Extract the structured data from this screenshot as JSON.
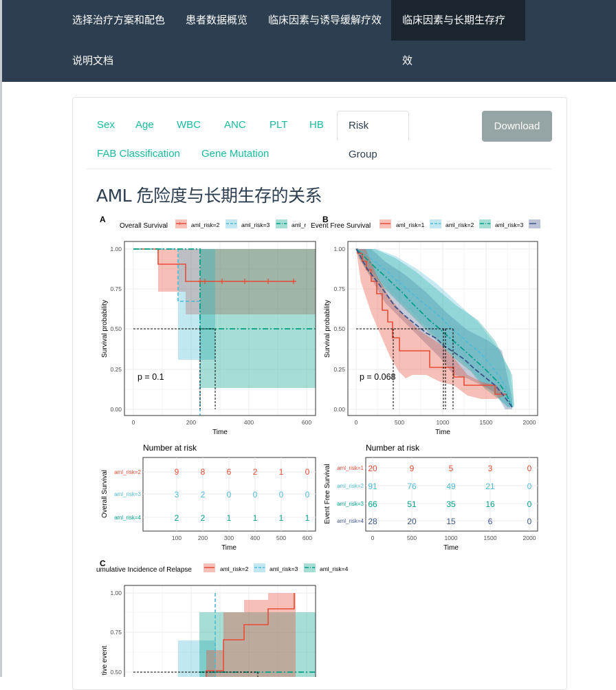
{
  "navbar": {
    "items": [
      "选择治疗方案和配色",
      "患者数据概览",
      "临床因素与诱导缓解疗效",
      "临床因素与长期生存疗效",
      "说明文档"
    ],
    "active_index": 3
  },
  "tabs": {
    "items": [
      "Sex",
      "Age",
      "WBC",
      "ANC",
      "PLT",
      "HB",
      "Risk Group",
      "FAB Classification",
      "Gene Mutation"
    ],
    "active": "Risk Group"
  },
  "download_label": "Download",
  "page_title": "AML 危险度与长期生存的关系",
  "colors": {
    "risk1": "#e64b35",
    "risk2": "#4dbbd5",
    "risk3": "#00a087",
    "risk4": "#3c5488",
    "nav_bg": "#2c3e50",
    "tab_link": "#18bc9c"
  },
  "figure": {
    "panel_a": {
      "letter": "A",
      "legend_title": "Overall Survival",
      "legend_items": [
        "aml_risk=2",
        "aml_risk=3",
        "aml_r"
      ],
      "ylabel": "Survival probability",
      "xlabel": "Time",
      "pvalue": "p = 0.1",
      "y_ticks": [
        "0.00",
        "0.25",
        "0.50",
        "0.75",
        "1.00"
      ],
      "x_ticks": [
        "0",
        "200",
        "400",
        "600"
      ],
      "risk_table": {
        "title": "Number at risk",
        "ylabel": "Overall Survival",
        "xlabel": "Time",
        "x_ticks": [
          "100",
          "200",
          "300",
          "400",
          "500",
          "600"
        ],
        "rows": [
          {
            "label": "aml_risk=2",
            "values": [
              "9",
              "8",
              "6",
              "2",
              "1",
              "0"
            ]
          },
          {
            "label": "aml_risk=3",
            "values": [
              "3",
              "2",
              "0",
              "0",
              "0",
              "0"
            ]
          },
          {
            "label": "aml_risk=4",
            "values": [
              "2",
              "2",
              "1",
              "1",
              "1",
              "1"
            ]
          }
        ]
      }
    },
    "panel_b": {
      "letter": "B",
      "legend_title": "Event Free Survival",
      "legend_items": [
        "aml_risk=1",
        "aml_risk=2",
        "aml_risk=3"
      ],
      "ylabel": "Survival probability",
      "xlabel": "Time",
      "pvalue": "p = 0.068",
      "y_ticks": [
        "0.00",
        "0.25",
        "0.50",
        "0.75",
        "1.00"
      ],
      "x_ticks": [
        "0",
        "500",
        "1000",
        "1500",
        "2000"
      ],
      "risk_table": {
        "title": "Number at risk",
        "ylabel": "Event Free Survival",
        "xlabel": "Time",
        "x_ticks": [
          "0",
          "500",
          "1000",
          "1500",
          "2000"
        ],
        "rows": [
          {
            "label": "aml_risk=1",
            "values": [
              "20",
              "9",
              "5",
              "3",
              "0"
            ]
          },
          {
            "label": "aml_risk=2",
            "values": [
              "91",
              "76",
              "49",
              "21",
              "0"
            ]
          },
          {
            "label": "aml_risk=3",
            "values": [
              "66",
              "51",
              "35",
              "16",
              "0"
            ]
          },
          {
            "label": "aml_risk=4",
            "values": [
              "28",
              "20",
              "15",
              "6",
              "0"
            ]
          }
        ]
      }
    },
    "panel_c": {
      "letter": "C",
      "legend_title": "umulative Incidence of Relapse",
      "legend_items": [
        "aml_risk=2",
        "aml_risk=3",
        "aml_risk=4"
      ],
      "ylabel": "tive event",
      "y_ticks": [
        "0.50",
        "0.75",
        "1.00"
      ]
    }
  }
}
